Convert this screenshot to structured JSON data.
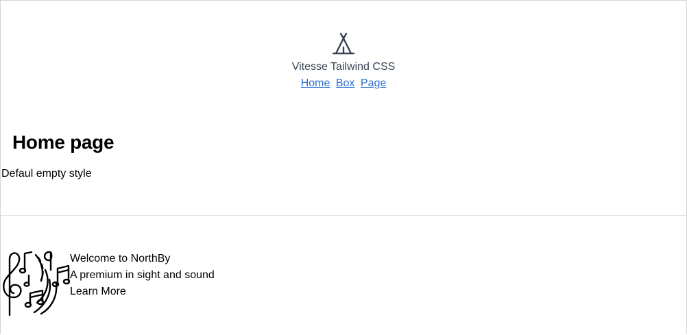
{
  "header": {
    "logo_icon": "tent-icon",
    "title": "Vitesse Tailwind CSS",
    "nav": [
      {
        "label": "Home"
      },
      {
        "label": "Box"
      },
      {
        "label": "Page"
      }
    ]
  },
  "main": {
    "title": "Home page",
    "description": "Defaul empty style"
  },
  "footer": {
    "art_icon": "music-notes-icon",
    "welcome": "Welcome to NorthBy",
    "tagline": "A premium in sight and sound",
    "cta": "Learn More"
  },
  "colors": {
    "link": "#2b6fd6",
    "title_text": "#374151",
    "border": "#d4d4d4"
  }
}
